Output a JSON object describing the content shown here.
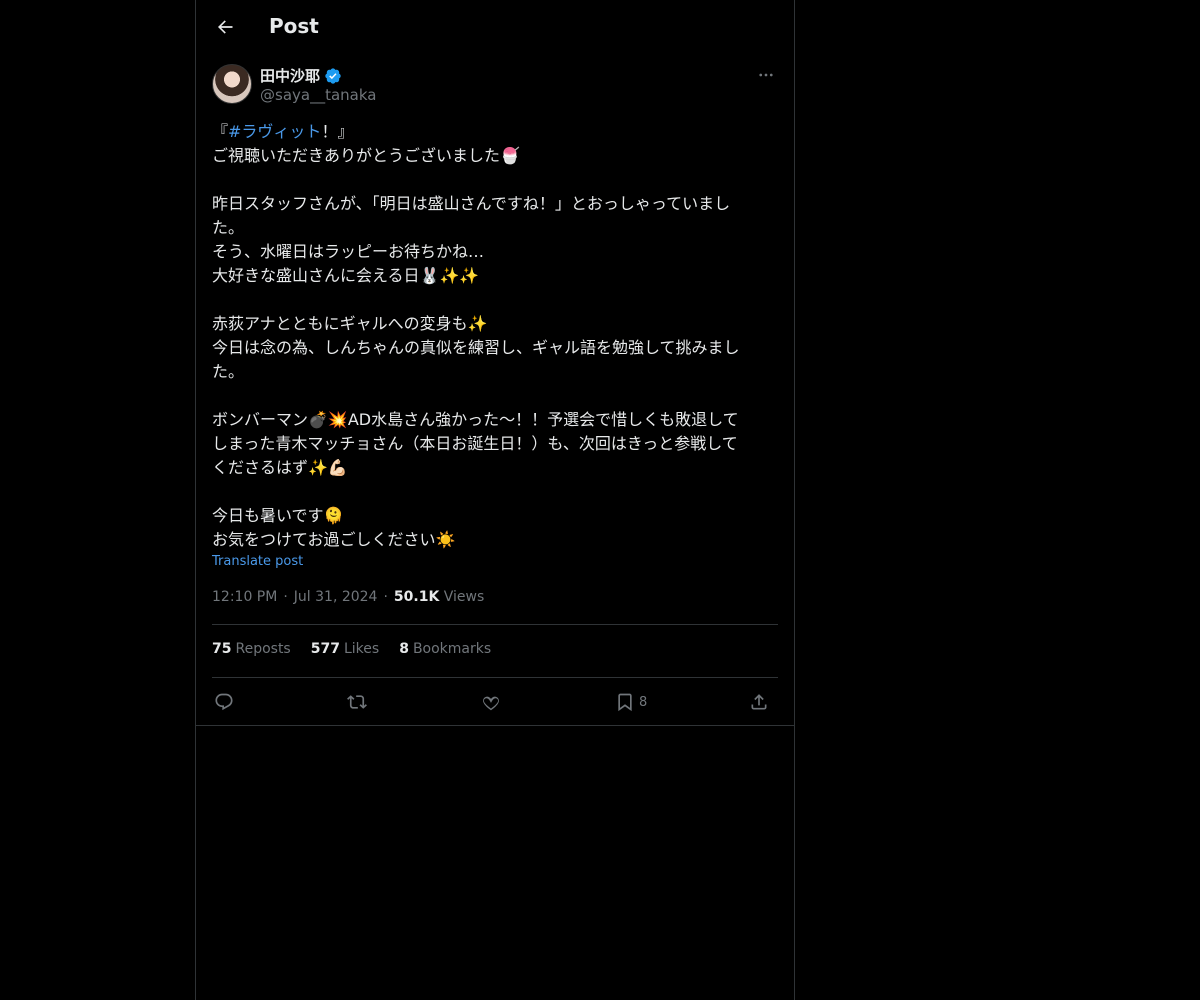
{
  "header": {
    "title": "Post"
  },
  "author": {
    "name": "田中沙耶",
    "handle": "@saya__tanaka"
  },
  "post": {
    "lines": [
      {
        "prefix": "『",
        "hashtag": "#ラヴィット",
        "suffix": "！』"
      },
      {
        "text": "ご視聴いただきありがとうございました🍧"
      },
      {
        "text": ""
      },
      {
        "text": "昨日スタッフさんが、「明日は盛山さんですね！」とおっしゃっていまし"
      },
      {
        "text": "た。"
      },
      {
        "text": "そう、水曜日はラッピーお待ちかね…"
      },
      {
        "text": "大好きな盛山さんに会える日🐰✨✨"
      },
      {
        "text": ""
      },
      {
        "text": "赤荻アナとともにギャルへの変身も✨"
      },
      {
        "text": "今日は念の為、しんちゃんの真似を練習し、ギャル語を勉強して挑みまし"
      },
      {
        "text": "た。"
      },
      {
        "text": ""
      },
      {
        "text": "ボンバーマン💣💥AD水島さん強かった〜！！予選会で惜しくも敗退して"
      },
      {
        "text": "しまった青木マッチョさん（本日お誕生日！）も、次回はきっと参戦して"
      },
      {
        "text": "くださるはず✨💪🏻"
      },
      {
        "text": ""
      },
      {
        "text": "今日も暑いです🫠"
      },
      {
        "text": "お気をつけてお過ごしください☀️"
      }
    ],
    "translate_label": "Translate post",
    "time": "12:10 PM",
    "date": "Jul 31, 2024",
    "dot": "·",
    "views_count": "50.1K",
    "views_label": "Views"
  },
  "stats": {
    "reposts_count": "75",
    "reposts_label": "Reposts",
    "likes_count": "577",
    "likes_label": "Likes",
    "bookmarks_count": "8",
    "bookmarks_label": "Bookmarks"
  },
  "actions": {
    "bookmark_count": "8"
  },
  "colors": {
    "background": "#000000",
    "text": "#e7e9ea",
    "secondary": "#71767b",
    "accent": "#4a99e9",
    "border": "#2f3336"
  },
  "icons": [
    "back-arrow-icon",
    "verified-badge-icon",
    "more-icon",
    "reply-icon",
    "repost-icon",
    "like-icon",
    "bookmark-icon",
    "share-icon"
  ]
}
